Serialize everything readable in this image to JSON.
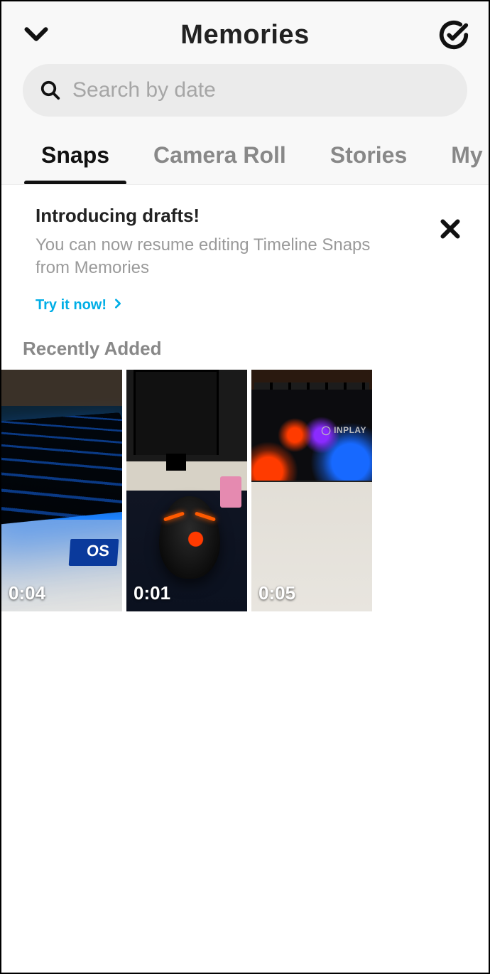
{
  "header": {
    "title": "Memories"
  },
  "search": {
    "placeholder": "Search by date",
    "value": ""
  },
  "tabs": [
    {
      "label": "Snaps",
      "active": true
    },
    {
      "label": "Camera Roll",
      "active": false
    },
    {
      "label": "Stories",
      "active": false
    },
    {
      "label": "My Eyes Only",
      "active": false
    }
  ],
  "banner": {
    "title": "Introducing drafts!",
    "description": "You can now resume editing Timeline Snaps from Memories",
    "cta": "Try it now!"
  },
  "section": {
    "title": "Recently Added"
  },
  "snaps": [
    {
      "duration": "0:04",
      "selected": false,
      "desc": "blue-backlit-keyboard"
    },
    {
      "duration": "0:01",
      "selected": false,
      "desc": "gaming-mouse-on-mat"
    },
    {
      "duration": "0:05",
      "selected": true,
      "desc": "red-blue-keyboard-edge"
    }
  ],
  "colors": {
    "accent": "#00aee6",
    "selected_border": "#ff0000"
  }
}
